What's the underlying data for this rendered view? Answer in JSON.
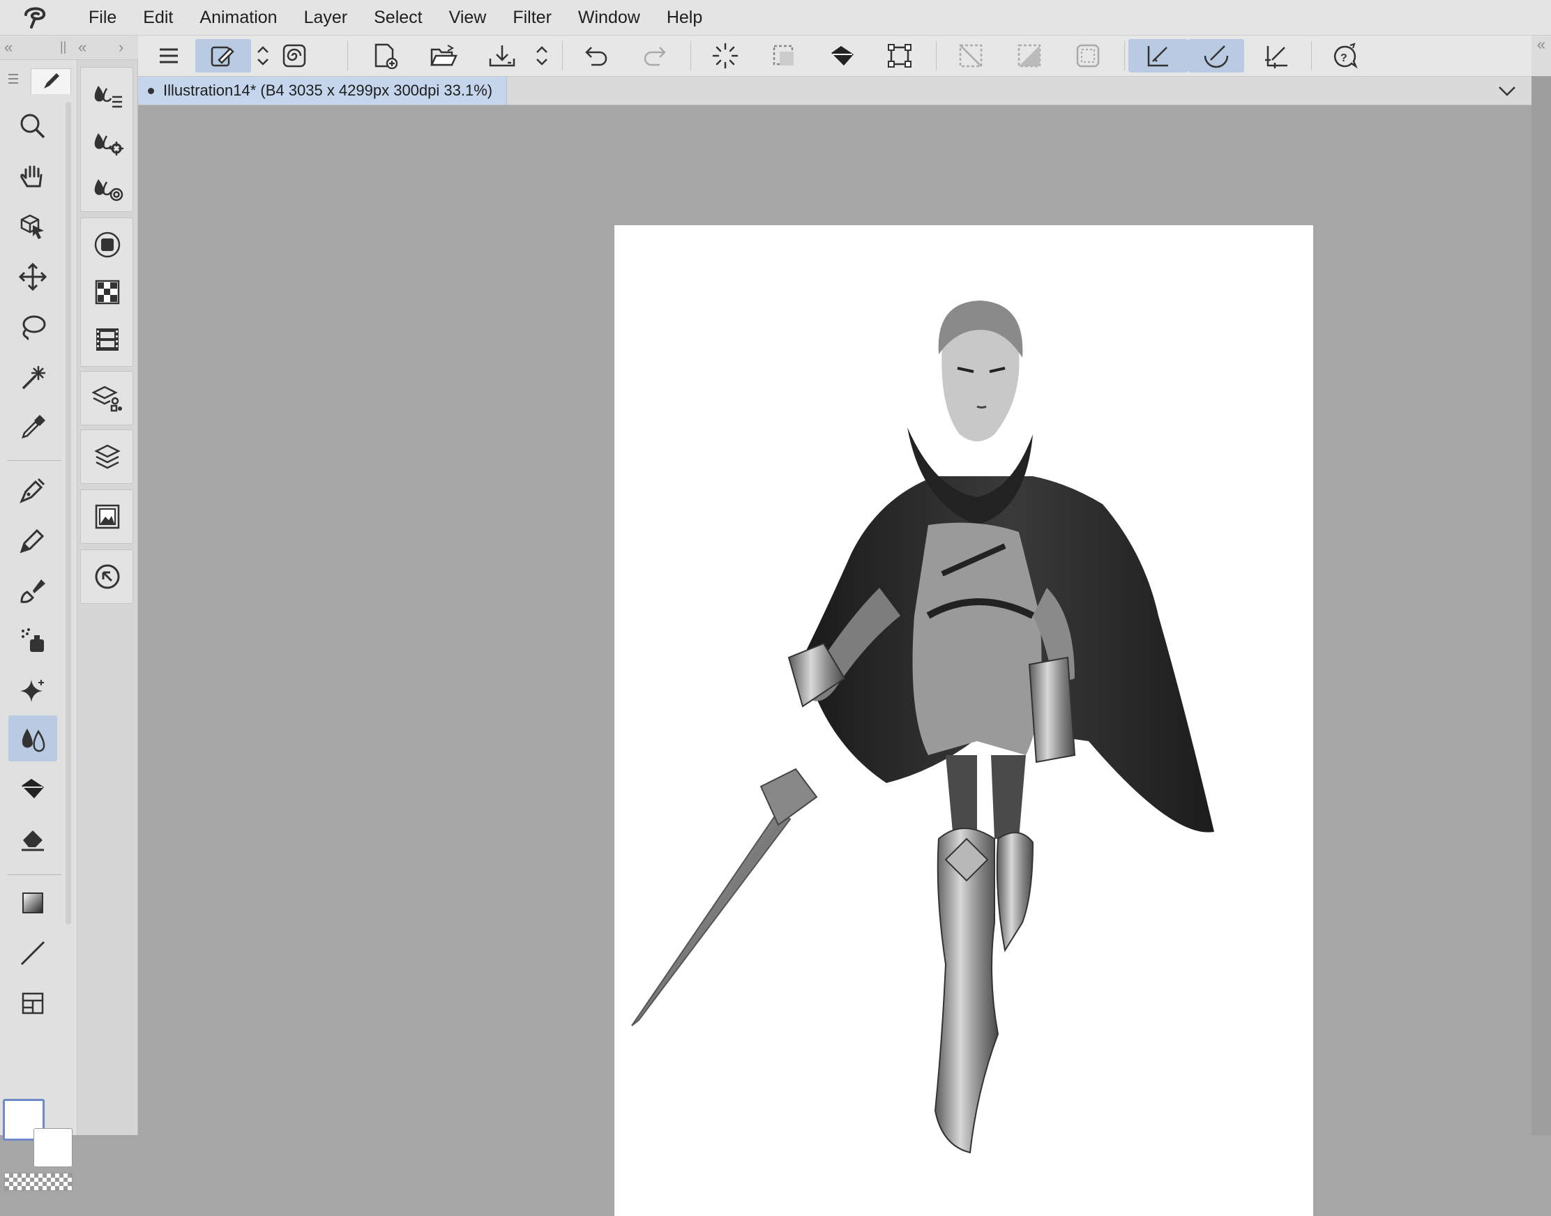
{
  "menubar": {
    "items": [
      "File",
      "Edit",
      "Animation",
      "Layer",
      "Select",
      "View",
      "Filter",
      "Window",
      "Help"
    ]
  },
  "collapse": {
    "left_double": "«",
    "grip": "||",
    "left_single": "«",
    "right_single": "›",
    "right_far": "«"
  },
  "commandbar": {
    "icons": [
      "menu-icon",
      "brush-settings-icon",
      "up-down-arrows-icon",
      "spiral-icon",
      "new-file-icon",
      "open-folder-icon",
      "save-icon",
      "up-down-arrows-icon",
      "undo-icon",
      "redo-icon",
      "loading-icon",
      "deselect-icon",
      "fill-icon",
      "transform-icon",
      "hide-selection-icon",
      "invert-selection-icon",
      "expand-selection-icon",
      "snap-ruler-icon",
      "snap-special-ruler-icon",
      "snap-grid-icon",
      "help-icon"
    ]
  },
  "document": {
    "tab_title": "Illustration14* (B4 3035 x 4299px 300dpi 33.1%)"
  },
  "tools": {
    "icons": [
      "zoom-icon",
      "hand-icon",
      "object-select-icon",
      "move-icon",
      "lasso-icon",
      "magic-wand-icon",
      "eyedropper-icon",
      "pen-icon",
      "pencil-icon",
      "brush-icon",
      "airbrush-icon",
      "decoration-icon",
      "blend-icon",
      "fill-icon",
      "eraser-icon",
      "gradient-icon",
      "line-icon",
      "frame-icon"
    ],
    "active": "blend-icon"
  },
  "subtools": {
    "icons": [
      "blend-list-icon",
      "blend-settings-icon",
      "blend-target-icon",
      "tool-property-icon",
      "color-set-icon",
      "animation-timeline-icon",
      "layer-property-icon",
      "layers-icon",
      "navigator-icon",
      "search-icon"
    ]
  },
  "colors": {
    "main": "#ffffff",
    "sub": "#ffffff",
    "accent": "#b9cbe3"
  }
}
